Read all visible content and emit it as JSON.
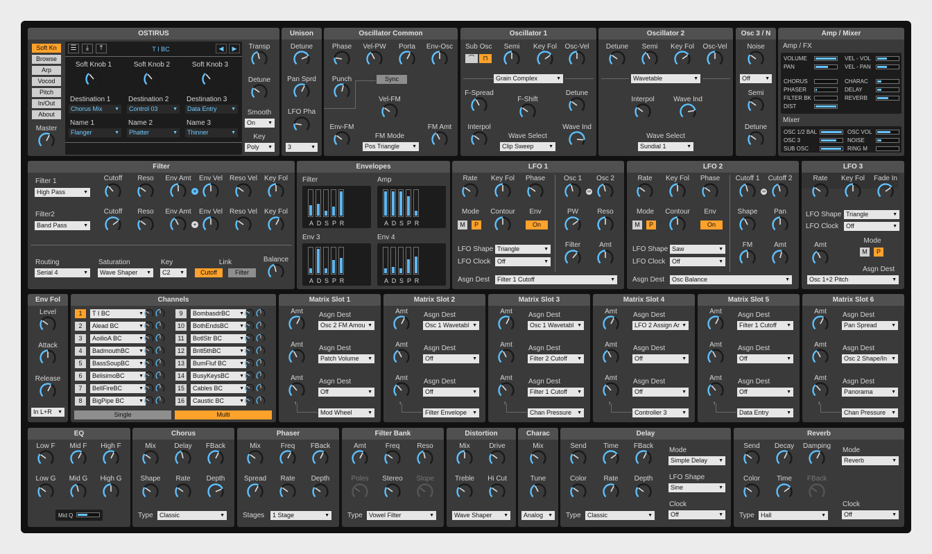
{
  "ostirus": {
    "title": "OSTIRUS",
    "side_buttons": [
      "Soft Kn",
      "Browse",
      "Arp",
      "Vocod",
      "Pitch",
      "In/Out",
      "About"
    ],
    "master": "Master",
    "preset": "T I BC",
    "softknobs": [
      "Soft Knob 1",
      "Soft Knob 2",
      "Soft Knob 3"
    ],
    "dests": [
      "Destination 1",
      "Destination 2",
      "Destination 3"
    ],
    "dest_vals": [
      "Chorus Mix",
      "Control 03",
      "Data Entry"
    ],
    "names": [
      "Name 1",
      "Name 2",
      "Name 3"
    ],
    "name_vals": [
      "Flanger",
      "Phatter",
      "Thinner"
    ],
    "transp": "Transp",
    "detune": "Detune",
    "smooth": "Smooth",
    "smooth_val": "On",
    "key": "Key",
    "key_val": "Poly"
  },
  "unison": {
    "title": "Unison",
    "detune": "Detune",
    "pan_sprd": "Pan Sprd",
    "lfo_pha": "LFO Pha",
    "voices": "3"
  },
  "osc_common": {
    "title": "Oscillator Common",
    "labels": [
      "Phase",
      "Vel-PW",
      "Porta",
      "Env-Osc"
    ],
    "punch": "Punch",
    "sync": "Sync",
    "vel_fm": "Vel-FM",
    "env_fm": "Env-FM",
    "fm_mode": "FM Mode",
    "fm_mode_val": "Pos Triangle",
    "fm_amt": "FM Amt"
  },
  "osc1": {
    "title": "Oscillator 1",
    "sub_osc": "Sub Osc",
    "semi": "Semi",
    "key_fol": "Key Fol",
    "osc_vel": "Osc-Vel",
    "model": "Grain Complex",
    "f_spread": "F-Spread",
    "f_shift": "F-Shift",
    "detune": "Detune",
    "interpol": "Interpol",
    "wave_select": "Wave Select",
    "wave_select_val": "Clip Sweep",
    "wave_ind": "Wave Ind"
  },
  "osc2": {
    "title": "Oscillator 2",
    "labels": [
      "Detune",
      "Semi",
      "Key Fol",
      "Osc-Vel"
    ],
    "model": "Wavetable",
    "interpol": "Interpol",
    "wave_ind": "Wave Ind",
    "wave_select": "Wave Select",
    "wave_select_val": "Sundial 1"
  },
  "osc3": {
    "title": "Osc 3 / N",
    "noise": "Noise",
    "mode": "Off",
    "semi": "Semi",
    "detune": "Detune"
  },
  "ampmix": {
    "title": "Amp / Mixer",
    "ampfx": "Amp / FX",
    "left": [
      {
        "l": "VOLUME",
        "v": 0.95
      },
      {
        "l": "PAN",
        "v": 0.55
      },
      {
        "l": "CHORUS",
        "v": 0
      },
      {
        "l": "PHASER",
        "v": 0.05
      },
      {
        "l": "FILTER BK",
        "v": 0
      },
      {
        "l": "DIST",
        "v": 0.95
      }
    ],
    "right": [
      {
        "l": "VEL - VOL",
        "v": 0.45
      },
      {
        "l": "VEL - PAN",
        "v": 0.45
      },
      {
        "l": "CHARAC",
        "v": 0.2
      },
      {
        "l": "DELAY",
        "v": 0.2
      },
      {
        "l": "REVERB",
        "v": 0.5
      }
    ],
    "mixer": "Mixer",
    "mleft": [
      {
        "l": "OSC 1/2 BAL",
        "v": 0.95
      },
      {
        "l": "OSC 3",
        "v": 0.7
      },
      {
        "l": "SUB OSC",
        "v": 0.9
      }
    ],
    "mright": [
      {
        "l": "OSC VOL",
        "v": 0.6
      },
      {
        "l": "NOISE",
        "v": 0.2
      },
      {
        "l": "RING M",
        "v": 0
      }
    ]
  },
  "filter": {
    "title": "Filter",
    "f1": "Filter 1",
    "f1_val": "High Pass",
    "f2": "Filter2",
    "f2_val": "Band Pass",
    "cols": [
      "Cutoff",
      "Reso",
      "Env Amt",
      "Env Vel",
      "Reso Vel",
      "Key Fol"
    ],
    "routing": "Routing",
    "routing_val": "Serial 4",
    "saturation": "Saturation",
    "saturation_val": "Wave Shaper",
    "key": "Key",
    "key_val": "C2",
    "link": "Link",
    "link_a": "Cutoff",
    "link_b": "Filter",
    "balance": "Balance"
  },
  "envelopes": {
    "title": "Envelopes",
    "names": [
      "Filter",
      "Amp",
      "Env 3",
      "Env 4"
    ],
    "letters": [
      "A",
      "D",
      "S",
      "P",
      "R"
    ],
    "levels": [
      [
        0.4,
        0.45,
        0.2,
        0.35,
        0.95
      ],
      [
        0.95,
        0.95,
        0.95,
        0.75,
        0.2
      ],
      [
        0.2,
        0.95,
        0.2,
        0.5,
        0.6
      ],
      [
        0.2,
        0.25,
        0.2,
        0.55,
        0.65
      ]
    ]
  },
  "lfo1": {
    "title": "LFO 1",
    "labels": [
      "Rate",
      "Key Fol",
      "Phase"
    ],
    "mode": "Mode",
    "m": "M",
    "p": "P",
    "contour": "Contour",
    "env": "Env",
    "env_val": "On",
    "osc1": "Osc 1",
    "osc2": "Osc 2",
    "pw": "PW",
    "reso": "Reso",
    "filter": "Filter",
    "amt": "Amt",
    "shape": "LFO Shape",
    "shape_val": "Triangle",
    "clock": "LFO Clock",
    "clock_val": "Off",
    "asgn": "Asgn Dest",
    "asgn_val": "Filter 1 Cutoff"
  },
  "lfo2": {
    "title": "LFO 2",
    "labels": [
      "Rate",
      "Key Fol",
      "Phase"
    ],
    "mode": "Mode",
    "m": "M",
    "p": "P",
    "contour": "Contour",
    "env": "Env",
    "env_val": "On",
    "cut1": "Cutoff 1",
    "cut2": "Cutoff 2",
    "shape": "Shape",
    "pan": "Pan",
    "fm": "FM",
    "amt": "Amt",
    "lshape": "LFO Shape",
    "lshape_val": "Saw",
    "clock": "LFO Clock",
    "clock_val": "Off",
    "asgn": "Asgn Dest",
    "asgn_val": "Osc Balance"
  },
  "lfo3": {
    "title": "LFO 3",
    "labels": [
      "Rate",
      "Key Fol",
      "Fade In"
    ],
    "shape": "LFO Shape",
    "shape_val": "Triangle",
    "clock": "LFO Clock",
    "clock_val": "Off",
    "amt": "Amt",
    "mode": "Mode",
    "m": "M",
    "p": "P",
    "asgn": "Asgn Dest",
    "asgn_val": "Osc 1+2 Pitch"
  },
  "envfol": {
    "title": "Env Fol",
    "level": "Level",
    "attack": "Attack",
    "release": "Release",
    "input": "In L+R"
  },
  "channels": {
    "title": "Channels",
    "left": [
      [
        "1",
        "T I BC"
      ],
      [
        "2",
        "Alead BC"
      ],
      [
        "3",
        "AoilioA BC"
      ],
      [
        "4",
        "BadmouthBC"
      ],
      [
        "5",
        "BassSoupBC"
      ],
      [
        "6",
        "BelisimoBC"
      ],
      [
        "7",
        "BellFireBC"
      ],
      [
        "8",
        "BigPipe BC"
      ]
    ],
    "right": [
      [
        "9",
        "BombasdrBC"
      ],
      [
        "10",
        "BothEndsBC"
      ],
      [
        "11",
        "BotlStr BC"
      ],
      [
        "12",
        "Britl5thBC"
      ],
      [
        "13",
        "BumFluf BC"
      ],
      [
        "14",
        "BusyKeysBC"
      ],
      [
        "15",
        "Cables BC"
      ],
      [
        "16",
        "Caustic BC"
      ]
    ],
    "single": "Single",
    "multi": "Multi"
  },
  "matrix": [
    {
      "title": "Matrix Slot 1",
      "rows": [
        "Osc 2 FM Amou",
        "Patch Volume",
        "Off"
      ],
      "src": "Mod Wheel"
    },
    {
      "title": "Matrix Slot 2",
      "rows": [
        "Osc 1 Wavetabl",
        "Off",
        "Off"
      ],
      "src": "Filter Envelope"
    },
    {
      "title": "Matrix Slot 3",
      "rows": [
        "Osc 1 Wavetabl",
        "Filter 2 Cutoff",
        "Filter 1 Cutoff"
      ],
      "src": "Chan Pressure"
    },
    {
      "title": "Matrix Slot 4",
      "rows": [
        "LFO 2 Assign Ar",
        "Off",
        "Off"
      ],
      "src": "Controller 3"
    },
    {
      "title": "Matrix Slot 5",
      "rows": [
        "Filter 1 Cutoff",
        "Off",
        "Off"
      ],
      "src": "Data Entry"
    },
    {
      "title": "Matrix Slot 6",
      "rows": [
        "Pan Spread",
        "Osc 2 Shape/In",
        "Panorama"
      ],
      "src": "Chan Pressure"
    }
  ],
  "matrix_labels": {
    "amt": "Amt",
    "asgn": "Asgn Dest"
  },
  "eq": {
    "title": "EQ",
    "top": [
      "Low F",
      "Mid F",
      "High F"
    ],
    "bottom": [
      "Low G",
      "Mid G",
      "High G"
    ],
    "midq": "Mid Q"
  },
  "chorus": {
    "title": "Chorus",
    "top": [
      "Mix",
      "Delay",
      "FBack"
    ],
    "bottom": [
      "Shape",
      "Rate",
      "Depth"
    ],
    "type": "Type",
    "type_val": "Classic"
  },
  "phaser": {
    "title": "Phaser",
    "top": [
      "Mix",
      "Freq",
      "FBack"
    ],
    "bottom": [
      "Spread",
      "Rate",
      "Depth"
    ],
    "stages": "Stages",
    "stages_val": "1 Stage"
  },
  "filterbank": {
    "title": "Filter Bank",
    "top": [
      "Amt",
      "Freq",
      "Reso"
    ],
    "bottom": [
      "Poles",
      "Stereo",
      "Slope"
    ],
    "type": "Type",
    "type_val": "Vowel Filter"
  },
  "distortion": {
    "title": "Distortion",
    "top": [
      "Mix",
      "Drive"
    ],
    "bottom": [
      "Treble",
      "Hi Cut"
    ],
    "type_val": "Wave Shaper"
  },
  "charac": {
    "title": "Charac",
    "mix": "Mix",
    "tune": "Tune",
    "type_val": "Analog"
  },
  "delay": {
    "title": "Delay",
    "top": [
      "Send",
      "Time",
      "FBack"
    ],
    "bottom": [
      "Color",
      "Rate",
      "Depth"
    ],
    "type": "Type",
    "type_val": "Classic",
    "mode": "Mode",
    "mode_val": "Simple Delay",
    "lfo_shape": "LFO Shape",
    "lfo_shape_val": "Sine",
    "clock": "Clock",
    "clock_val": "Off"
  },
  "reverb": {
    "title": "Reverb",
    "top": [
      "Send",
      "Decay",
      "Damping"
    ],
    "bottom": [
      "Color",
      "Time",
      "FBack"
    ],
    "type": "Type",
    "type_val": "Hall",
    "mode": "Mode",
    "mode_val": "Reverb",
    "clock": "Clock",
    "clock_val": "Off"
  },
  "colors": {
    "accent": "#ffa22b",
    "knob_blue": "#5fc1ff",
    "panel": "#3a3a3a",
    "header": "#505050"
  }
}
